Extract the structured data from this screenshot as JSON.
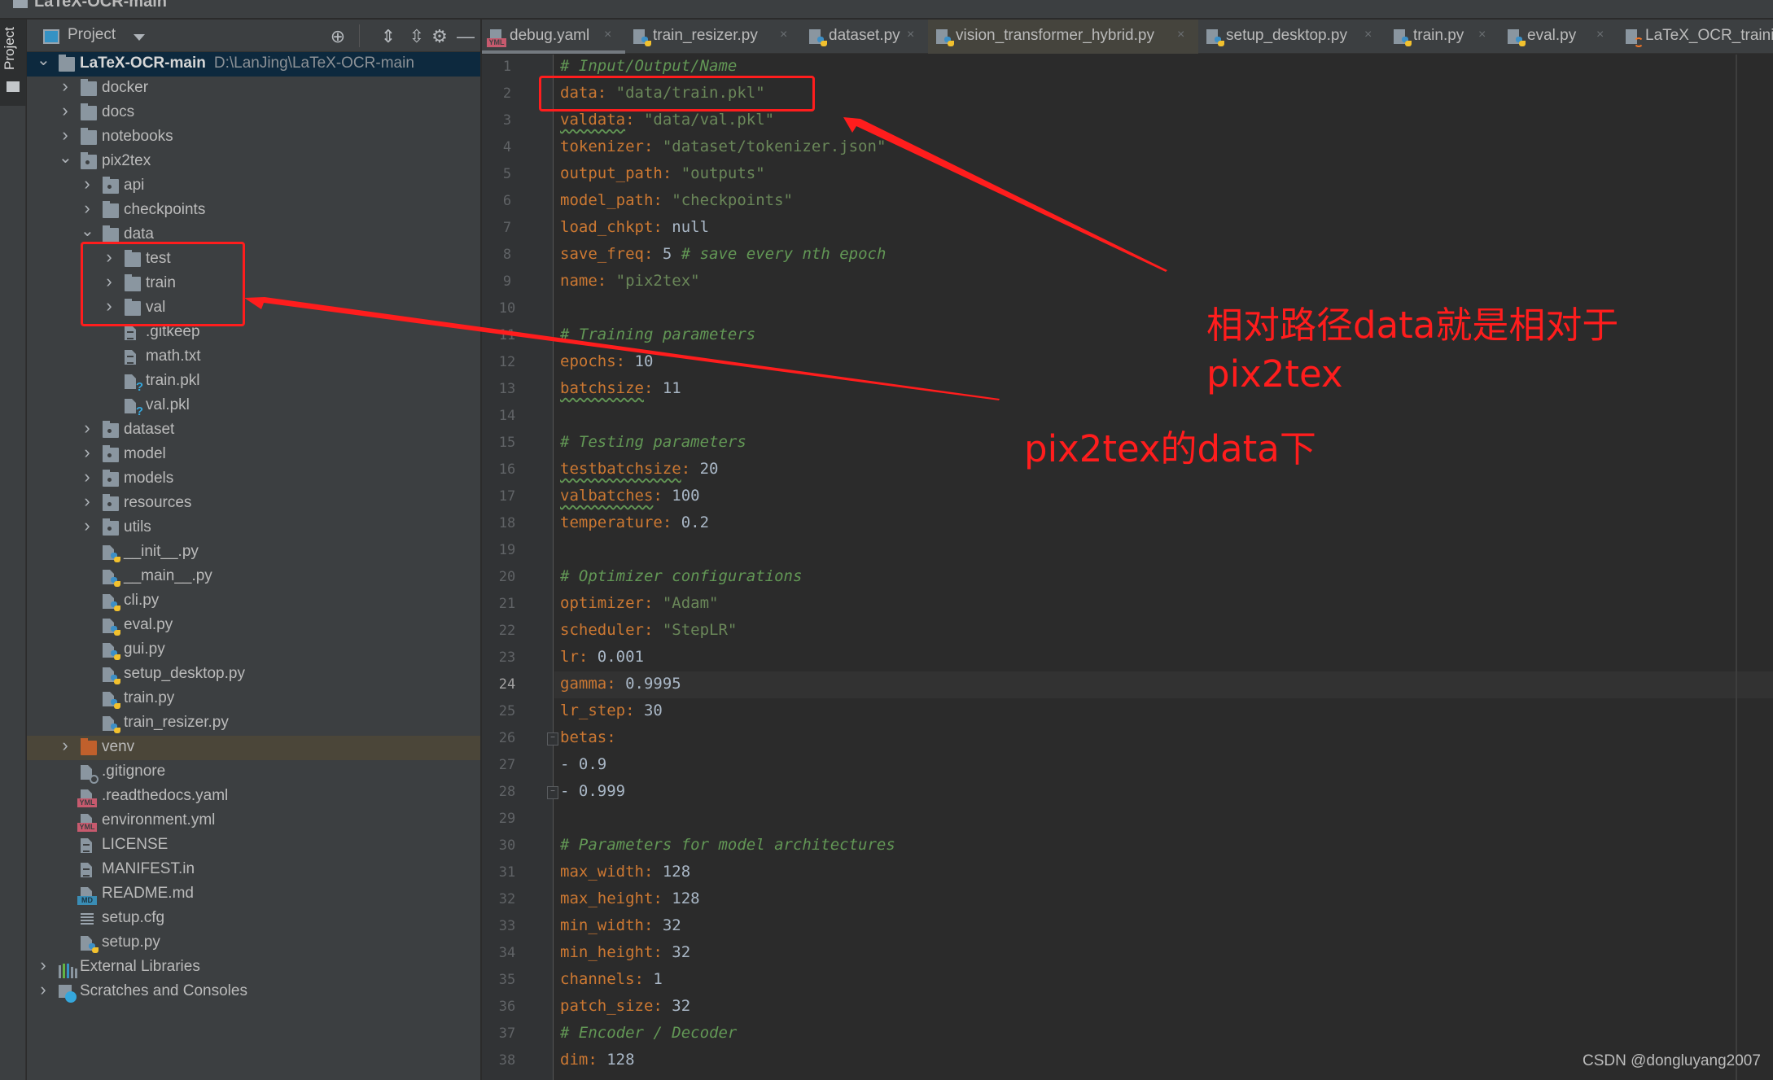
{
  "window": {
    "title": "LaTeX-OCR-main"
  },
  "stripe": {
    "label": "Project"
  },
  "project_panel": {
    "title": "Project",
    "tools": [
      "locate-icon",
      "expand-all-icon",
      "collapse-all-icon",
      "gear-icon",
      "minimize-icon"
    ]
  },
  "tree": [
    {
      "label": "LaTeX-OCR-main",
      "path": "D:\\LanJing\\LaTeX-OCR-main",
      "depth": 0,
      "type": "folder",
      "expanded": true,
      "selected": true,
      "bold": true
    },
    {
      "label": "docker",
      "depth": 1,
      "type": "folder",
      "expanded": false
    },
    {
      "label": "docs",
      "depth": 1,
      "type": "folder",
      "expanded": false
    },
    {
      "label": "notebooks",
      "depth": 1,
      "type": "folder",
      "expanded": false
    },
    {
      "label": "pix2tex",
      "depth": 1,
      "type": "package",
      "expanded": true
    },
    {
      "label": "api",
      "depth": 2,
      "type": "package",
      "expanded": false
    },
    {
      "label": "checkpoints",
      "depth": 2,
      "type": "folder",
      "expanded": false
    },
    {
      "label": "data",
      "depth": 2,
      "type": "folder",
      "expanded": true
    },
    {
      "label": "test",
      "depth": 3,
      "type": "folder",
      "expanded": false
    },
    {
      "label": "train",
      "depth": 3,
      "type": "folder",
      "expanded": false
    },
    {
      "label": "val",
      "depth": 3,
      "type": "folder",
      "expanded": false
    },
    {
      "label": ".gitkeep",
      "depth": 4,
      "type": "text"
    },
    {
      "label": "math.txt",
      "depth": 4,
      "type": "text"
    },
    {
      "label": "train.pkl",
      "depth": 4,
      "type": "unknown"
    },
    {
      "label": "val.pkl",
      "depth": 4,
      "type": "unknown"
    },
    {
      "label": "dataset",
      "depth": 2,
      "type": "package",
      "expanded": false
    },
    {
      "label": "model",
      "depth": 2,
      "type": "package",
      "expanded": false
    },
    {
      "label": "models",
      "depth": 2,
      "type": "package",
      "expanded": false
    },
    {
      "label": "resources",
      "depth": 2,
      "type": "package",
      "expanded": false
    },
    {
      "label": "utils",
      "depth": 2,
      "type": "package",
      "expanded": false
    },
    {
      "label": "__init__.py",
      "depth": 3,
      "type": "python"
    },
    {
      "label": "__main__.py",
      "depth": 3,
      "type": "python"
    },
    {
      "label": "cli.py",
      "depth": 3,
      "type": "python"
    },
    {
      "label": "eval.py",
      "depth": 3,
      "type": "python"
    },
    {
      "label": "gui.py",
      "depth": 3,
      "type": "python"
    },
    {
      "label": "setup_desktop.py",
      "depth": 3,
      "type": "python"
    },
    {
      "label": "train.py",
      "depth": 3,
      "type": "python"
    },
    {
      "label": "train_resizer.py",
      "depth": 3,
      "type": "python"
    },
    {
      "label": "venv",
      "depth": 1,
      "type": "venv",
      "expanded": false,
      "highlighted": true
    },
    {
      "label": ".gitignore",
      "depth": 2,
      "type": "ignore"
    },
    {
      "label": ".readthedocs.yaml",
      "depth": 2,
      "type": "yaml"
    },
    {
      "label": "environment.yml",
      "depth": 2,
      "type": "yaml"
    },
    {
      "label": "LICENSE",
      "depth": 2,
      "type": "text"
    },
    {
      "label": "MANIFEST.in",
      "depth": 2,
      "type": "text"
    },
    {
      "label": "README.md",
      "depth": 2,
      "type": "markdown"
    },
    {
      "label": "setup.cfg",
      "depth": 2,
      "type": "config"
    },
    {
      "label": "setup.py",
      "depth": 2,
      "type": "python"
    },
    {
      "label": "External Libraries",
      "depth": 0,
      "type": "libraries",
      "expanded": false
    },
    {
      "label": "Scratches and Consoles",
      "depth": 0,
      "type": "scratches",
      "expanded": false
    }
  ],
  "tabs": [
    {
      "label": "debug.yaml",
      "type": "yaml",
      "active": true
    },
    {
      "label": "train_resizer.py",
      "type": "python"
    },
    {
      "label": "dataset.py",
      "type": "python"
    },
    {
      "label": "vision_transformer_hybrid.py",
      "type": "python",
      "dim": true
    },
    {
      "label": "setup_desktop.py",
      "type": "python"
    },
    {
      "label": "train.py",
      "type": "python"
    },
    {
      "label": "eval.py",
      "type": "python"
    },
    {
      "label": "LaTeX_OCR_training",
      "type": "jupyter"
    }
  ],
  "editor": {
    "current_line": 24,
    "lines": [
      [
        [
          "c",
          "# Input/Output/Name"
        ]
      ],
      [
        [
          "k",
          "data"
        ],
        [
          "p",
          ": "
        ],
        [
          "s",
          "\"data/train.pkl\""
        ]
      ],
      [
        [
          "kw",
          "valdata"
        ],
        [
          "p",
          ": "
        ],
        [
          "s",
          "\"data/val.pkl\""
        ]
      ],
      [
        [
          "k",
          "tokenizer"
        ],
        [
          "p",
          ": "
        ],
        [
          "s",
          "\"dataset/tokenizer.json\""
        ]
      ],
      [
        [
          "k",
          "output_path"
        ],
        [
          "p",
          ": "
        ],
        [
          "s",
          "\"outputs\""
        ]
      ],
      [
        [
          "k",
          "model_path"
        ],
        [
          "p",
          ": "
        ],
        [
          "s",
          "\"checkpoints\""
        ]
      ],
      [
        [
          "k",
          "load_chkpt"
        ],
        [
          "p",
          ": "
        ],
        [
          "n",
          "null"
        ]
      ],
      [
        [
          "k",
          "save_freq"
        ],
        [
          "p",
          ": "
        ],
        [
          "n",
          "5 "
        ],
        [
          "c",
          "# save every nth epoch"
        ]
      ],
      [
        [
          "k",
          "name"
        ],
        [
          "p",
          ": "
        ],
        [
          "s",
          "\"pix2tex\""
        ]
      ],
      [],
      [
        [
          "c",
          "# Training parameters"
        ]
      ],
      [
        [
          "k",
          "epochs"
        ],
        [
          "p",
          ": "
        ],
        [
          "n",
          "10"
        ]
      ],
      [
        [
          "kw",
          "batchsize"
        ],
        [
          "p",
          ": "
        ],
        [
          "n",
          "11"
        ]
      ],
      [],
      [
        [
          "c",
          "# Testing parameters"
        ]
      ],
      [
        [
          "kw",
          "testbatchsize"
        ],
        [
          "p",
          ": "
        ],
        [
          "n",
          "20"
        ]
      ],
      [
        [
          "kw",
          "valbatches"
        ],
        [
          "p",
          ": "
        ],
        [
          "n",
          "100"
        ]
      ],
      [
        [
          "k",
          "temperature"
        ],
        [
          "p",
          ": "
        ],
        [
          "n",
          "0.2"
        ]
      ],
      [],
      [
        [
          "c",
          "# Optimizer configurations"
        ]
      ],
      [
        [
          "k",
          "optimizer"
        ],
        [
          "p",
          ": "
        ],
        [
          "s",
          "\"Adam\""
        ]
      ],
      [
        [
          "k",
          "scheduler"
        ],
        [
          "p",
          ": "
        ],
        [
          "s",
          "\"StepLR\""
        ]
      ],
      [
        [
          "k",
          "lr"
        ],
        [
          "p",
          ": "
        ],
        [
          "n",
          "0.001"
        ]
      ],
      [
        [
          "k",
          "gamma"
        ],
        [
          "p",
          ": "
        ],
        [
          "n",
          "0.9995"
        ]
      ],
      [
        [
          "k",
          "lr_step"
        ],
        [
          "p",
          ": "
        ],
        [
          "n",
          "30"
        ]
      ],
      [
        [
          "k",
          "betas"
        ],
        [
          "p",
          ":"
        ]
      ],
      [
        [
          "n",
          "- 0.9"
        ]
      ],
      [
        [
          "n",
          "- 0.999"
        ]
      ],
      [],
      [
        [
          "c",
          "# Parameters for model architectures"
        ]
      ],
      [
        [
          "k",
          "max_width"
        ],
        [
          "p",
          ": "
        ],
        [
          "n",
          "128"
        ]
      ],
      [
        [
          "k",
          "max_height"
        ],
        [
          "p",
          ": "
        ],
        [
          "n",
          "128"
        ]
      ],
      [
        [
          "k",
          "min_width"
        ],
        [
          "p",
          ": "
        ],
        [
          "n",
          "32"
        ]
      ],
      [
        [
          "k",
          "min_height"
        ],
        [
          "p",
          ": "
        ],
        [
          "n",
          "32"
        ]
      ],
      [
        [
          "k",
          "channels"
        ],
        [
          "p",
          ": "
        ],
        [
          "n",
          "1"
        ]
      ],
      [
        [
          "k",
          "patch_size"
        ],
        [
          "p",
          ": "
        ],
        [
          "n",
          "32"
        ]
      ],
      [
        [
          "c",
          "# Encoder / Decoder"
        ]
      ],
      [
        [
          "k",
          "dim"
        ],
        [
          "p",
          ": "
        ],
        [
          "n",
          "128"
        ]
      ]
    ],
    "fold_markers": [
      26,
      28
    ]
  },
  "annotations": {
    "note1_line1": "相对路径data就是相对于",
    "note1_line2": "pix2tex",
    "note2": "pix2tex的data下",
    "color": "#ff1d1d"
  },
  "watermark": "CSDN @dongluyang2007",
  "colors": {
    "key": "#cc7832",
    "string": "#6a8759",
    "number": "#a9b7c6",
    "comment": "#629755",
    "selection": "#0d293e",
    "highlight_row": "#4b4639"
  }
}
